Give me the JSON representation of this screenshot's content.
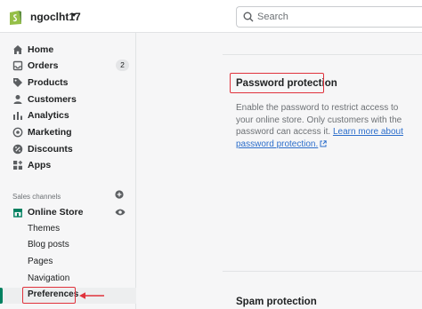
{
  "topbar": {
    "store_name": "ngoclht17",
    "search_placeholder": "Search"
  },
  "sidebar": {
    "items": [
      {
        "label": "Home",
        "icon": "home-icon"
      },
      {
        "label": "Orders",
        "icon": "orders-icon",
        "badge": "2"
      },
      {
        "label": "Products",
        "icon": "tag-icon"
      },
      {
        "label": "Customers",
        "icon": "person-icon"
      },
      {
        "label": "Analytics",
        "icon": "bar-chart-icon"
      },
      {
        "label": "Marketing",
        "icon": "target-icon"
      },
      {
        "label": "Discounts",
        "icon": "discount-icon"
      },
      {
        "label": "Apps",
        "icon": "apps-icon"
      }
    ],
    "sales_channels_label": "Sales channels",
    "online_store": {
      "label": "Online Store",
      "icon": "store-icon"
    },
    "sub_items": [
      {
        "label": "Themes"
      },
      {
        "label": "Blog posts"
      },
      {
        "label": "Pages"
      },
      {
        "label": "Navigation"
      },
      {
        "label": "Preferences",
        "active": true
      }
    ]
  },
  "main": {
    "password_protection": {
      "title": "Password protection",
      "description": "Enable the password to restrict access to your online store. Only customers with the password can access it.",
      "link": "Learn more about password protection."
    },
    "spam_protection": {
      "title": "Spam protection"
    }
  },
  "colors": {
    "accent_green": "#008060",
    "link_blue": "#2c6ecb",
    "annotation_red": "#e0323c"
  }
}
